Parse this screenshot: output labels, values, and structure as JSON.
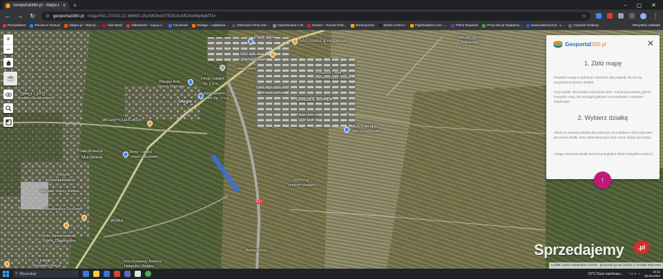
{
  "browser": {
    "tab_title": "Geoportal360.pl - Mapa Intera...",
    "new_tab": "+",
    "window_controls": [
      "–",
      "▢",
      "✕"
    ],
    "url_host": "geoportal360.pl",
    "url_path": "/map/#51.27042,22.66669.15z/MDIwOTE0bzIuMDAwMy4yMTk=",
    "bookmarks": [
      {
        "label": "Rozrywka24",
        "color": "#d33"
      },
      {
        "label": "Poczta w Onet.pl",
        "color": "#1e88e5"
      },
      {
        "label": "Allegro.pl - Więcej...",
        "color": "#ff5a00"
      },
      {
        "label": "Alior Bank",
        "color": "#b71c1c"
      },
      {
        "label": "AliExpress – kupuj o...",
        "color": "#e43225"
      },
      {
        "label": "Facebook",
        "color": "#1877f2"
      },
      {
        "label": "Orange – najlepsze...",
        "color": "#ff7900"
      },
      {
        "label": "Darmowe Filmy HD...",
        "color": "#555"
      },
      {
        "label": "Importowane z IE",
        "color": "#888"
      },
      {
        "label": "Envelo – Poczta Pols...",
        "color": "#c62828"
      },
      {
        "label": "Dreamyorion",
        "color": "#ffb300"
      },
      {
        "label": "Strefa CANAL+",
        "color": "#222"
      },
      {
        "label": "Flightradar24.com -...",
        "color": "#ffa000"
      },
      {
        "label": "FitGirl Repacks",
        "color": "#8e24aa"
      },
      {
        "label": "PrzyLinie.pl Najlepszy...",
        "color": "#43a047"
      },
      {
        "label": "www.kubbe112.pl - L...",
        "color": "#1565c0"
      },
      {
        "label": "Asystent Szalony",
        "color": "#666"
      }
    ],
    "bookmarks_right": "Wszystkie zakładki"
  },
  "map": {
    "zoom_in": "+",
    "zoom_out": "−",
    "places": [
      {
        "name": "Biedronka",
        "cls": ""
      },
      {
        "name": "SAS rooms & restaurant",
        "cls": ""
      },
      {
        "name": "Pizza Turka",
        "cls": ""
      },
      {
        "name": "Bistro Borek",
        "cls": ""
      },
      {
        "name": "Lublin Tatary",
        "cls": "small"
      },
      {
        "name": "Wargas Auto",
        "cls": "small"
      },
      {
        "name": "Serwis Naprawy",
        "cls": "small"
      },
      {
        "name": "PPHU SIMBA",
        "cls": "small"
      },
      {
        "name": "Sp. z o.o.",
        "cls": "small"
      },
      {
        "name": "Krzysztof Lalak -",
        "cls": "small"
      },
      {
        "name": "Refleksologia, Masaż",
        "cls": "small"
      },
      {
        "name": "Turkai Spółdzielnia",
        "cls": "small"
      },
      {
        "name": "Mieszkaniowa",
        "cls": "small"
      },
      {
        "name": "Skaj-System",
        "cls": "small"
      },
      {
        "name": "Lublin Sp. z o.o.",
        "cls": "small"
      },
      {
        "name": "OSIEDLE BOREK",
        "cls": ""
      },
      {
        "name": "Długie",
        "cls": ""
      },
      {
        "name": "MICHAPYCHA LUBLIN",
        "cls": "small"
      },
      {
        "name": "Pałac z r. 1870",
        "cls": "small"
      },
      {
        "name": "rodziny Grodzickich",
        "cls": "small"
      },
      {
        "name": "Niepubliczne",
        "cls": "small"
      },
      {
        "name": "Przedszkole",
        "cls": "small"
      },
      {
        "name": "Oleje mało płyta",
        "cls": "small"
      },
      {
        "name": "olej z czarnuszki",
        "cls": "small"
      },
      {
        "name": "Jakubowice",
        "cls": ""
      },
      {
        "name": "Murowane",
        "cls": ""
      },
      {
        "name": "Bmw - części",
        "cls": "small"
      },
      {
        "name": "nowe i używane",
        "cls": "small"
      },
      {
        "name": "Kościół",
        "cls": "small"
      },
      {
        "name": "Rzymskokatolicki",
        "cls": "small"
      },
      {
        "name": "Ośrodek Gminy Wólka",
        "cls": "small"
      },
      {
        "name": "Restauracja Gościniec",
        "cls": "small"
      },
      {
        "name": "ROKO w",
        "cls": "small"
      },
      {
        "name": "centrum designu",
        "cls": "small"
      },
      {
        "name": "Wólka",
        "cls": ""
      },
      {
        "name": "Grillo Samochodowy",
        "cls": "small"
      },
      {
        "name": "Lublin, Diagnostyka",
        "cls": "small"
      },
      {
        "name": "Wilczek Jerzy",
        "cls": "small"
      },
      {
        "name": "Autoserwis",
        "cls": "small"
      },
      {
        "name": "Vico Przewozy Niemcy",
        "cls": "small"
      },
      {
        "name": "Holandia / Belgia",
        "cls": "small"
      },
      {
        "name": "Okręgowa Stacja",
        "cls": "small"
      },
      {
        "name": "KAME",
        "cls": "small"
      },
      {
        "name": "S17",
        "cls": "small"
      },
      {
        "name": "Bezbolesny…",
        "cls": "small"
      }
    ]
  },
  "panel": {
    "logo_main": "Geoportal",
    "logo_suffix": "360.pl",
    "close": "✕",
    "step1_title": "1. Zbliż mapę",
    "step1_p1": "Powiększ mapę w wybranym obszarze aby pojawiły się na niej wyrysowane granice działek.",
    "step1_p2": "Użyj myszki, skorzystaj z przycisków plus i minus przy prawej, górnej krawędzi mapy, lub rozciągnij palcami na urządzeniu z ekranem dotykowym.",
    "step2_title": "2. Wybierz działkę",
    "step2_p1": "Kliknij na wybraną działkę aby zobaczyć szczegółowe informacje takie jak numer działki, dane administracyjne oraz numer księgi wieczystej.",
    "step2_p2": "Księgę wieczystą działki możesz przeglądać dzięki KsiegiWieczyste.pl",
    "fab": "↑"
  },
  "watermark": {
    "text": "Sprzedajemy",
    "badge": ".pl"
  },
  "attribution": "Leaflet | Dane katastralne GUGiK - geoportal.gov.pl (2016), © Google Map Data",
  "taskbar": {
    "search_placeholder": "Wyszukaj",
    "weather": "23°C  Duże zachmurz...",
    "time": "15:11",
    "date": "30.05.2024",
    "tray_icons": "ˆ  ▭  ◐  ⌁"
  },
  "colors": {
    "accent": "#c2187a",
    "brand_blue": "#2a6bb3",
    "brand_orange": "#e0892e",
    "watermark_badge": "#d72d2d"
  }
}
